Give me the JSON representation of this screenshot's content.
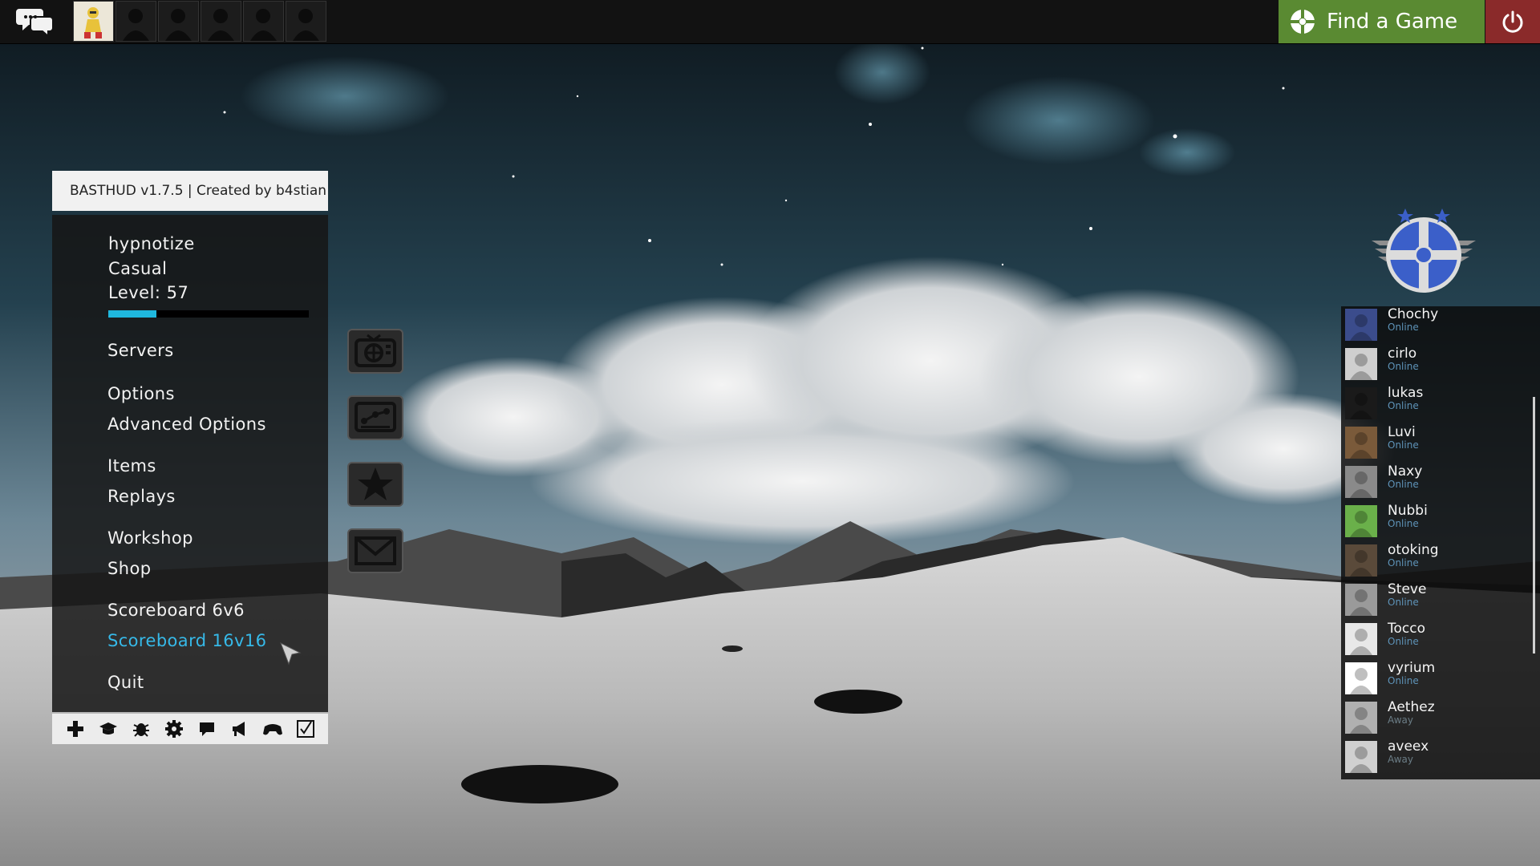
{
  "topbar": {
    "chat_icon": "speech-bubbles-icon",
    "party_slots": [
      {
        "state": "filled",
        "icon": "yellow-character-avatar"
      },
      {
        "state": "empty",
        "icon": "silhouette-icon"
      },
      {
        "state": "empty",
        "icon": "silhouette-icon"
      },
      {
        "state": "empty",
        "icon": "silhouette-icon"
      },
      {
        "state": "empty",
        "icon": "silhouette-icon"
      },
      {
        "state": "empty",
        "icon": "silhouette-icon"
      }
    ],
    "find_game_label": "Find a Game",
    "find_game_color": "#5a8a32",
    "quit_icon": "power-icon",
    "quit_color": "#8a2a2a"
  },
  "menu": {
    "version": "BASTHUD v1.7.5 | Created by b4stian",
    "player": {
      "name": "hypnotize",
      "mode": "Casual",
      "level": "Level: 57",
      "progress": 0.24
    },
    "items": [
      {
        "label": "Servers",
        "active": false
      },
      {
        "label": "Options",
        "active": false
      },
      {
        "label": "Advanced Options",
        "active": false
      },
      {
        "label": "Items",
        "active": false
      },
      {
        "label": "Replays",
        "active": false
      },
      {
        "label": "Workshop",
        "active": false
      },
      {
        "label": "Shop",
        "active": false
      },
      {
        "label": "Scoreboard 6v6",
        "active": false
      },
      {
        "label": "Scoreboard 16v16",
        "active": true
      },
      {
        "label": "Quit",
        "active": false
      }
    ],
    "accent_color": "#36b9e8",
    "toolbar_icons": [
      "plus-icon",
      "graduation-cap-icon",
      "bug-icon",
      "gear-icon",
      "speech-icon",
      "megaphone-icon",
      "controller-icon",
      "checkbox-icon"
    ]
  },
  "side_buttons": [
    "tv-icon",
    "workshop-icon",
    "star-icon",
    "mail-icon"
  ],
  "friends": [
    {
      "name": "Chochy",
      "status": "Online",
      "avatar": "#3b4c8c"
    },
    {
      "name": "cirlo",
      "status": "Online",
      "avatar": "#cfcfcf"
    },
    {
      "name": "lukas",
      "status": "Online",
      "avatar": "#1a1a1a"
    },
    {
      "name": "Luvi",
      "status": "Online",
      "avatar": "#7a5a3a"
    },
    {
      "name": "Naxy",
      "status": "Online",
      "avatar": "#8a8a8a"
    },
    {
      "name": "Nubbi",
      "status": "Online",
      "avatar": "#6ab04a"
    },
    {
      "name": "otoking",
      "status": "Online",
      "avatar": "#5a4a3a"
    },
    {
      "name": "Steve",
      "status": "Online",
      "avatar": "#9a9a9a"
    },
    {
      "name": "Tocco",
      "status": "Online",
      "avatar": "#e8e8e8"
    },
    {
      "name": "vyrium",
      "status": "Online",
      "avatar": "#ffffff"
    },
    {
      "name": "Aethez",
      "status": "Away",
      "avatar": "#b0b0b0"
    },
    {
      "name": "aveex",
      "status": "Away",
      "avatar": "#d0d0d0"
    }
  ],
  "status_colors": {
    "Online": "#5e93b8",
    "Away": "#6b7d86"
  }
}
